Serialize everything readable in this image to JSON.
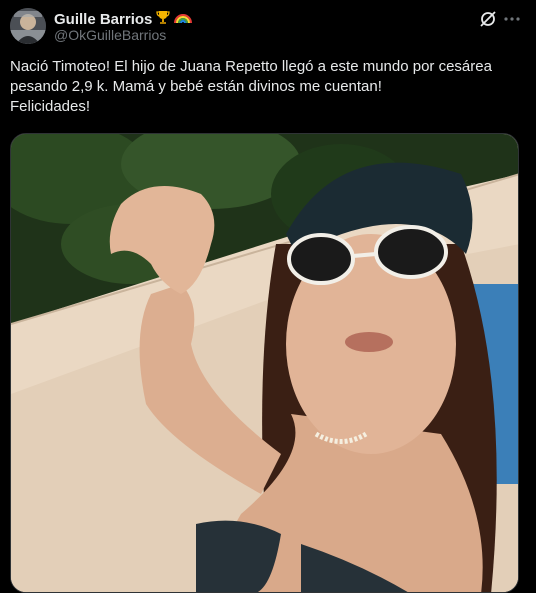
{
  "author": {
    "name": "Guille Barrios",
    "badges": [
      "trophy-emoji",
      "rainbow-emoji"
    ],
    "handle": "@OkGuilleBarrios"
  },
  "tweet": {
    "lines": [
      "Nació Timoteo! El hijo de Juana Repetto llegó a este mundo por cesárea",
      "pesando 2,9 k. Mamá y bebé están divinos me cuentan!",
      "Felicidades!"
    ]
  },
  "icons": {
    "grok": "grok-icon",
    "more": "more-icon"
  },
  "colors": {
    "background": "#000000",
    "text": "#e7e9ea",
    "secondary": "#71767b",
    "border": "#2f3336"
  }
}
